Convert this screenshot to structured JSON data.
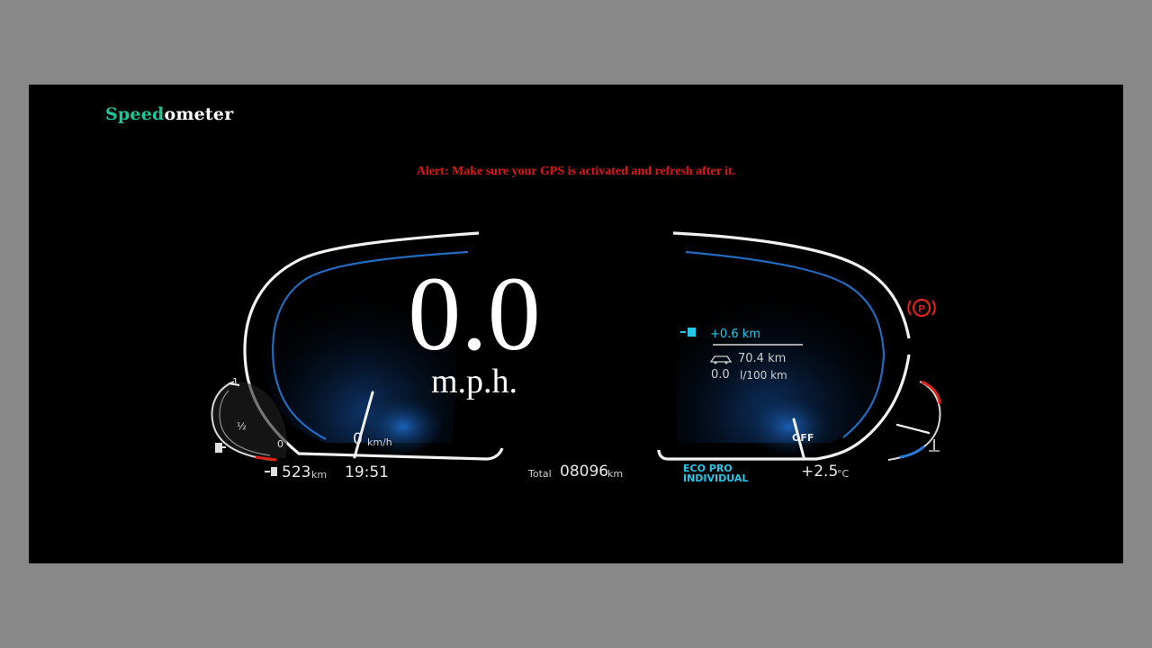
{
  "brand": {
    "prefix": "Speed",
    "suffix": "ometer"
  },
  "alert": "Alert: Make sure your GPS is activated and refresh after it.",
  "speed": {
    "value": "0.0",
    "unit": "m.p.h."
  },
  "cluster": {
    "needle_value": "0",
    "needle_unit": "km/h",
    "fuel_range_value": "523",
    "fuel_range_unit": "km",
    "clock": "19:51",
    "odometer_label": "Total",
    "odometer_value": "08096",
    "odometer_unit": "km",
    "eco_mode_line1": "ECO PRO",
    "eco_mode_line2": "INDIVIDUAL",
    "temperature_value": "+2.5",
    "temperature_unit": "°C",
    "eco_bonus": "+0.6 km",
    "trip_distance": "70.4 km",
    "consumption_value": "0.0",
    "consumption_unit": "l/100 km",
    "fuel_full_mark": "1",
    "fuel_half_mark": "½",
    "fuel_empty_mark": "0",
    "right_gauge_label": "OFF",
    "parking_brake": "P"
  },
  "colors": {
    "brand_accent": "#1fc59a",
    "alert": "#e01717",
    "cluster_blue": "#1f6fd0",
    "info_cyan": "#27c6e6",
    "warning_red": "#e2231a"
  },
  "icons": [
    "fuel-pump-icon",
    "range-fuel-icon",
    "eco-bonus-icon",
    "trip-car-icon",
    "coolant-temp-icon",
    "parking-brake-icon"
  ]
}
